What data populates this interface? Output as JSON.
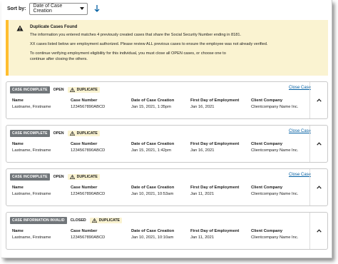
{
  "sort": {
    "label": "Sort by:",
    "selected": "Date of Case Creation"
  },
  "alert": {
    "title": "Duplicate Cases Found",
    "line1": "The information you entered matches 4 previously created cases that share the Social Security Number ending in 8181.",
    "line2": "XX cases listed below are employment authorized. Please review ALL previous cases to ensure the employee was not already verified.",
    "line3": "To continue verifying employment eligibility for this individual, you must close all OPEN cases, or choose one to",
    "line4": "continue after closing the others."
  },
  "headers": {
    "name": "Name",
    "case_number": "Case Number",
    "date_created": "Date of Case Creation",
    "first_day": "First Day of Employment",
    "client_company": "Client Company"
  },
  "close_label": "Close Case",
  "duplicate_label": "DUPLICATE",
  "cases": [
    {
      "status": "CASE INCOMPLETE",
      "state": "OPEN",
      "name": "Lastname, Firstname",
      "case_number": "1234567890ABCD",
      "date_created": "Jan 15, 2021, 1:35pm",
      "first_day": "Jan 16, 2021",
      "client_company": "Clientcompany Name Inc."
    },
    {
      "status": "CASE INCOMPLETE",
      "state": "OPEN",
      "name": "Lastname, Firstname",
      "case_number": "1234567890ABCD",
      "date_created": "Jan 15, 2021, 1:42pm",
      "first_day": "Jan 16, 2021",
      "client_company": "Clientcompany Name Inc."
    },
    {
      "status": "CASE INCOMPLETE",
      "state": "OPEN",
      "name": "Lastname, Firstname",
      "case_number": "1234567890ABCD",
      "date_created": "Jan 10, 2021, 10:53am",
      "first_day": "Jan 11, 2021",
      "client_company": "Clientcompany Name Inc."
    },
    {
      "status": "CASE INFORMATION INVALID",
      "state": "CLOSED",
      "name": "Lastname, Firstname",
      "case_number": "1234567890ABCD",
      "date_created": "Jan 10, 2021, 10:10am",
      "first_day": "Jan 11, 2021",
      "client_company": "Clientcompany Name Inc."
    }
  ],
  "colors": {
    "alert_bg": "#faf3d1",
    "alert_border": "#ffbe2e",
    "status_badge": "#71767a",
    "link": "#005ea2"
  }
}
